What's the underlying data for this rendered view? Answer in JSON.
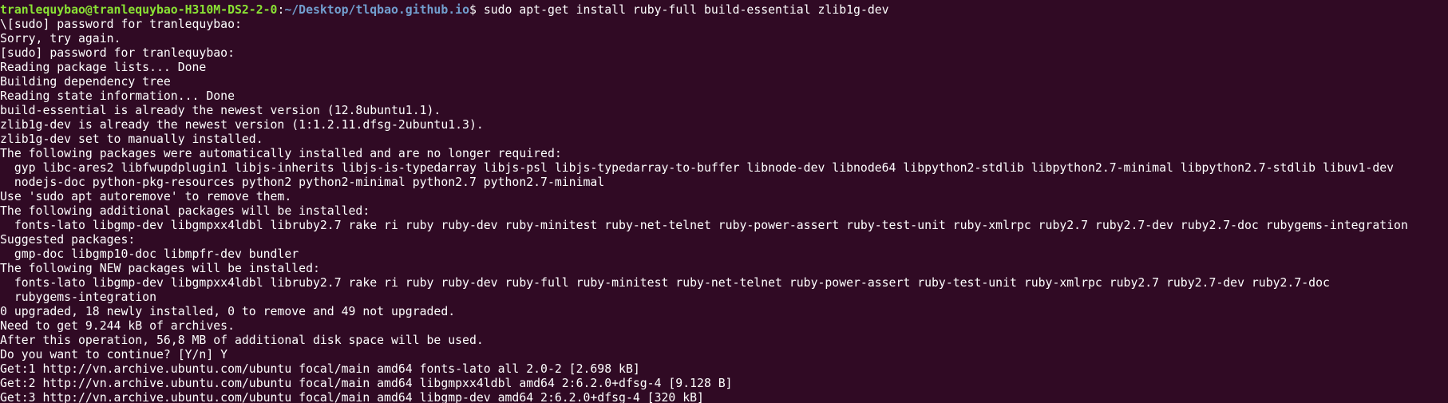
{
  "prompt": {
    "user_host": "tranlequybao@tranlequybao-H310M-DS2-2-0",
    "separator": ":",
    "path": "~/Desktop/tlqbao.github.io",
    "symbol": "$ ",
    "command": "sudo apt-get install ruby-full build-essential zlib1g-dev"
  },
  "lines": [
    "\\[sudo] password for tranlequybao:",
    "Sorry, try again.",
    "[sudo] password for tranlequybao:",
    "Reading package lists... Done",
    "Building dependency tree",
    "Reading state information... Done",
    "build-essential is already the newest version (12.8ubuntu1.1).",
    "zlib1g-dev is already the newest version (1:1.2.11.dfsg-2ubuntu1.3).",
    "zlib1g-dev set to manually installed.",
    "The following packages were automatically installed and are no longer required:",
    "  gyp libc-ares2 libfwupdplugin1 libjs-inherits libjs-is-typedarray libjs-psl libjs-typedarray-to-buffer libnode-dev libnode64 libpython2-stdlib libpython2.7-minimal libpython2.7-stdlib libuv1-dev",
    "  nodejs-doc python-pkg-resources python2 python2-minimal python2.7 python2.7-minimal",
    "Use 'sudo apt autoremove' to remove them.",
    "The following additional packages will be installed:",
    "  fonts-lato libgmp-dev libgmpxx4ldbl libruby2.7 rake ri ruby ruby-dev ruby-minitest ruby-net-telnet ruby-power-assert ruby-test-unit ruby-xmlrpc ruby2.7 ruby2.7-dev ruby2.7-doc rubygems-integration",
    "Suggested packages:",
    "  gmp-doc libgmp10-doc libmpfr-dev bundler",
    "The following NEW packages will be installed:",
    "  fonts-lato libgmp-dev libgmpxx4ldbl libruby2.7 rake ri ruby ruby-dev ruby-full ruby-minitest ruby-net-telnet ruby-power-assert ruby-test-unit ruby-xmlrpc ruby2.7 ruby2.7-dev ruby2.7-doc",
    "  rubygems-integration",
    "0 upgraded, 18 newly installed, 0 to remove and 49 not upgraded.",
    "Need to get 9.244 kB of archives.",
    "After this operation, 56,8 MB of additional disk space will be used.",
    "Do you want to continue? [Y/n] Y",
    "Get:1 http://vn.archive.ubuntu.com/ubuntu focal/main amd64 fonts-lato all 2.0-2 [2.698 kB]",
    "Get:2 http://vn.archive.ubuntu.com/ubuntu focal/main amd64 libgmpxx4ldbl amd64 2:6.2.0+dfsg-4 [9.128 B]",
    "Get:3 http://vn.archive.ubuntu.com/ubuntu focal/main amd64 libgmp-dev amd64 2:6.2.0+dfsg-4 [320 kB]"
  ],
  "colors": {
    "background": "#300a24",
    "text": "#ffffff",
    "prompt_user": "#8ae234",
    "prompt_path": "#729fcf"
  }
}
